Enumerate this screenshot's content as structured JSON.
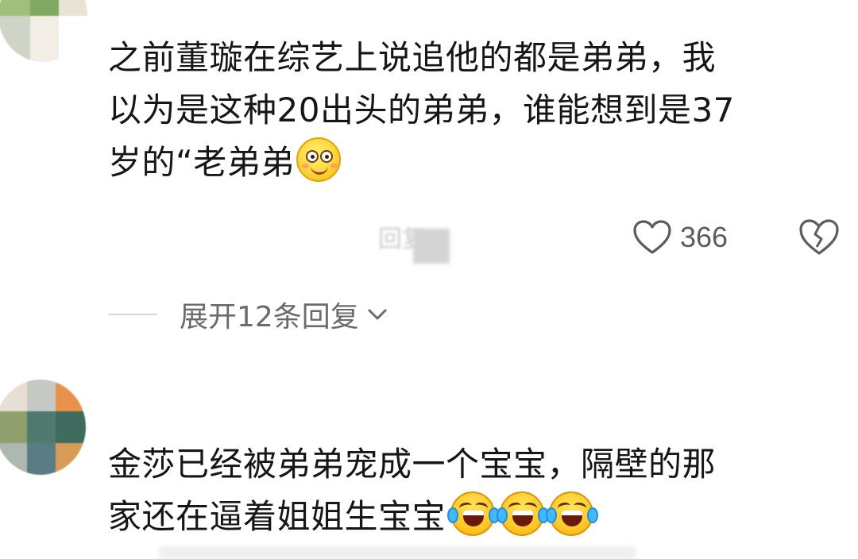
{
  "comments": [
    {
      "lines": [
        "之前董璇在综艺上说追他的都是弟弟，我",
        "以为是这种20出头的弟弟，谁能想到是37",
        "岁的“老弟弟"
      ],
      "emoji": "smile-emoji",
      "reply_hint": "回复",
      "like_count": "366",
      "expand_replies": "展开12条回复"
    },
    {
      "lines": [
        "金莎已经被弟弟宠成一个宝宝，隔壁的那",
        "家还在逼着姐姐生宝宝"
      ],
      "emoji": "laugh-cry-emoji",
      "emoji_count": 3
    }
  ],
  "colors": {
    "text": "#161616",
    "meta": "#5c5c5c",
    "expand": "#6b6b6b",
    "divider": "#d6d6d6"
  }
}
